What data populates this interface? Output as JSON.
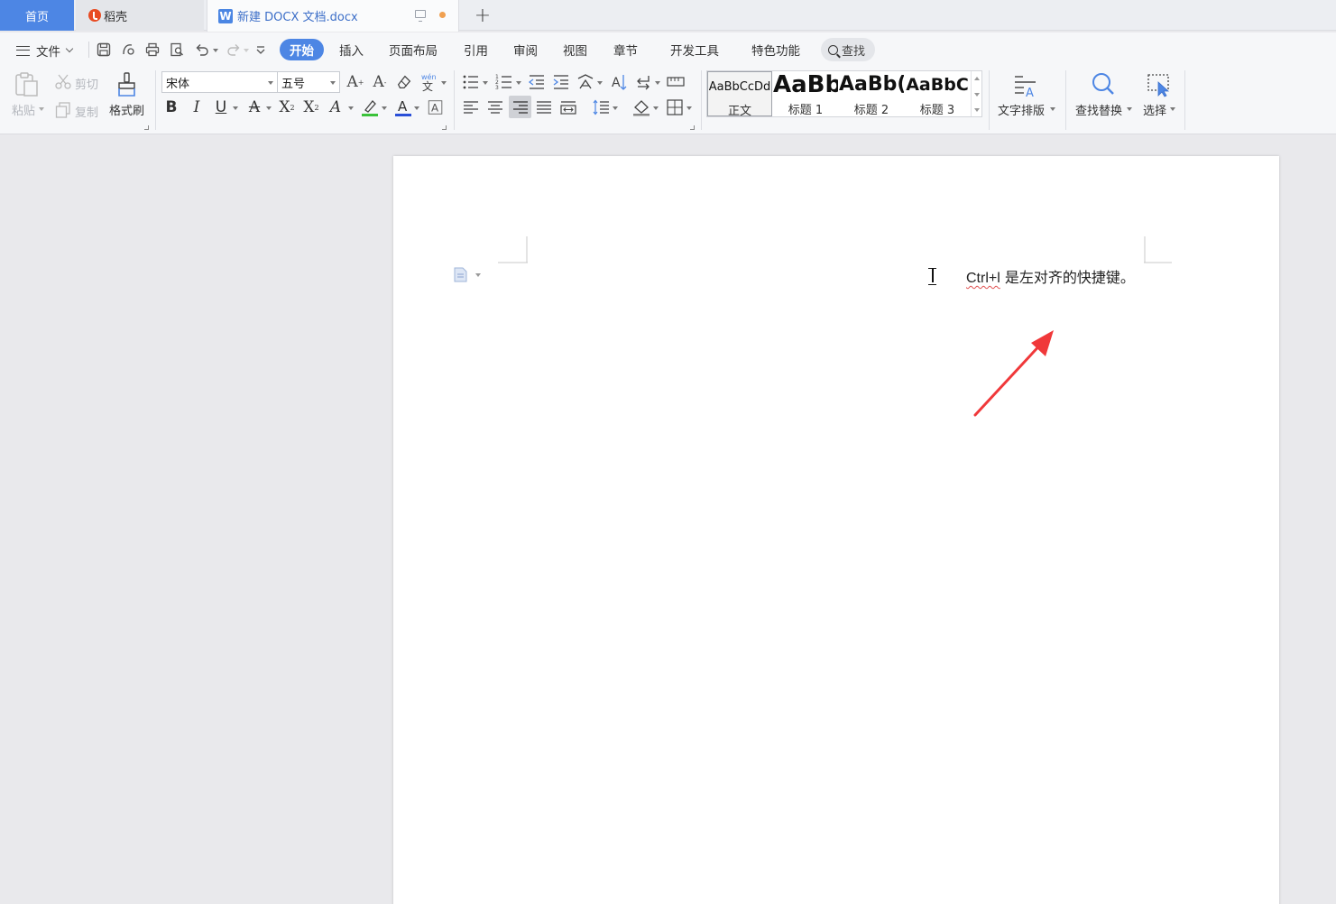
{
  "tabs": {
    "home": "首页",
    "daoke": "稻壳",
    "document": "新建 DOCX 文档.docx",
    "add": "+"
  },
  "menu": {
    "file": "文件",
    "search": "查找",
    "tabs": [
      "开始",
      "插入",
      "页面布局",
      "引用",
      "审阅",
      "视图",
      "章节",
      "开发工具",
      "特色功能"
    ]
  },
  "ribbon": {
    "paste": "粘贴",
    "cut": "剪切",
    "copy": "复制",
    "format_painter": "格式刷",
    "font_name": "宋体",
    "font_size": "五号",
    "bold": "B",
    "italic": "I",
    "underline": "U",
    "styles": [
      {
        "sample": "AaBbCcDd",
        "name": "正文"
      },
      {
        "sample": "AaBb",
        "name": "标题 1"
      },
      {
        "sample": "AaBb(",
        "name": "标题 2"
      },
      {
        "sample": "AaBbC",
        "name": "标题 3"
      }
    ],
    "text_layout": "文字排版",
    "find_replace": "查找替换",
    "select": "选择"
  },
  "document": {
    "text_prefix": "Ctrl+l",
    "text_suffix": " 是左对齐的快捷键。"
  },
  "colors": {
    "accent": "#4d86e4",
    "arrow": "#f0383a",
    "highlight": "#3ac23a",
    "font_color": "#2a4fd8"
  }
}
